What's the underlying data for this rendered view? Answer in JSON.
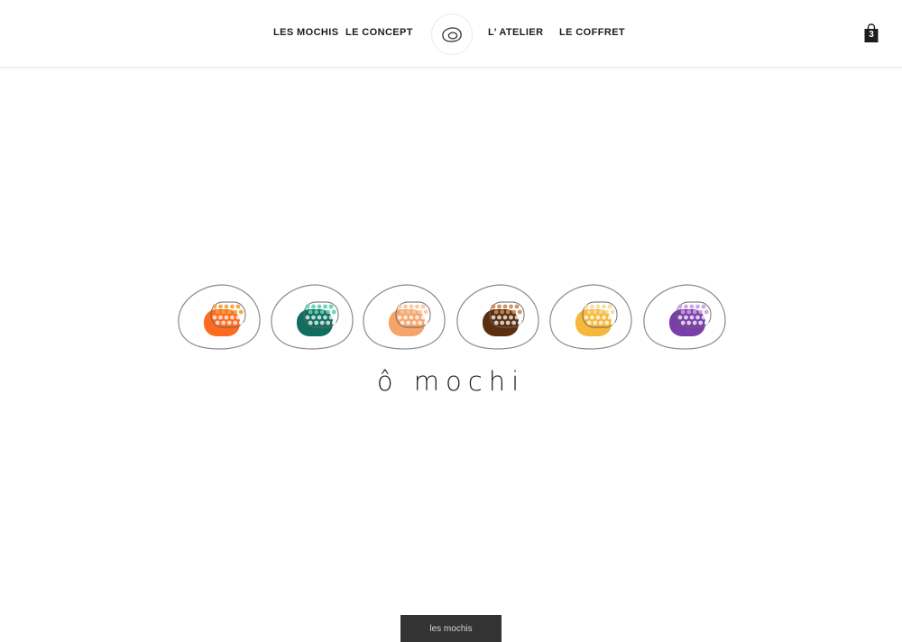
{
  "nav": {
    "items": [
      {
        "label": "LES MOCHIS"
      },
      {
        "label": "LE CONCEPT"
      },
      {
        "label": "L’ ATELIER"
      },
      {
        "label": "LE COFFRET"
      }
    ],
    "logo_icon": "mochi-outline-icon"
  },
  "cart": {
    "icon": "shopping-bag-icon",
    "count": "3"
  },
  "mochis": [
    {
      "flavor_color": "#ff6a1f",
      "accent_color": "#f0a23a"
    },
    {
      "flavor_color": "#0f6e5e",
      "accent_color": "#5fcfb0"
    },
    {
      "flavor_color": "#f5a46a",
      "accent_color": "#f8c7a0"
    },
    {
      "flavor_color": "#5a2e0e",
      "accent_color": "#c98a55"
    },
    {
      "flavor_color": "#f6b73a",
      "accent_color": "#f8dc98"
    },
    {
      "flavor_color": "#7a3ea8",
      "accent_color": "#c7a0e0"
    }
  ],
  "brand": {
    "name": "ô mochi"
  },
  "bottom_button": {
    "label": "les mochis"
  },
  "colors": {
    "text": "#1c1c1c",
    "button_bg": "#333333",
    "button_text": "#d6d6d6"
  }
}
